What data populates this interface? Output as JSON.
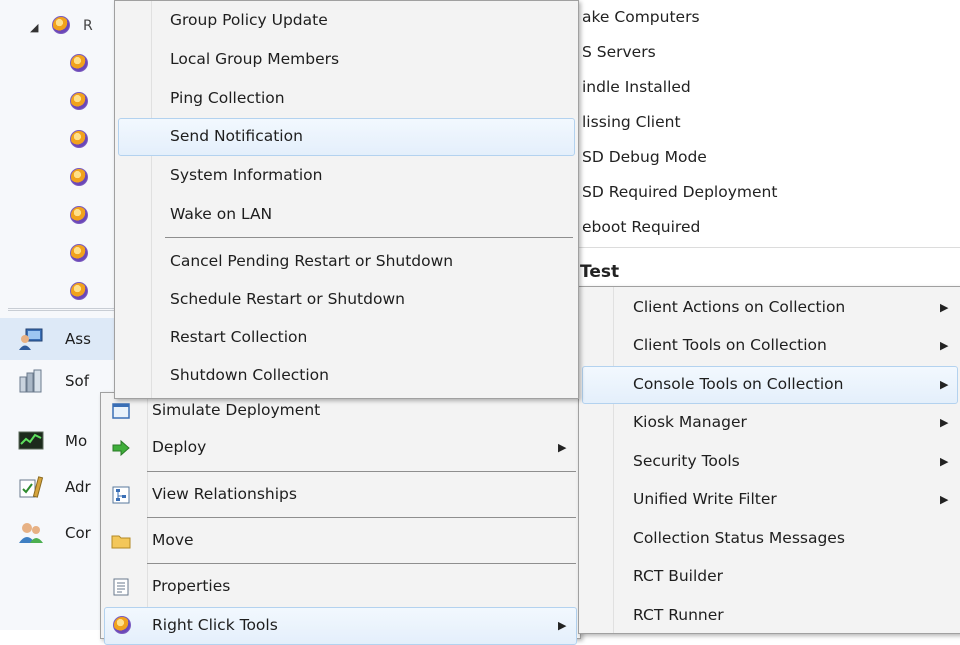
{
  "tree": {
    "root_label": "R",
    "workspaces": [
      {
        "label": "Ass",
        "icon": "assets-icon"
      },
      {
        "label": "Sof",
        "icon": "software-library-icon"
      },
      {
        "label": "Mo",
        "icon": "monitoring-icon"
      },
      {
        "label": "Adr",
        "icon": "administration-icon"
      },
      {
        "label": "Cor",
        "icon": "community-icon"
      }
    ]
  },
  "background_list": {
    "items": [
      "ake Computers",
      "S Servers",
      "indle Installed",
      "lissing Client",
      "SD Debug Mode",
      "SD Required Deployment",
      "eboot Required"
    ],
    "heading": "Test"
  },
  "context_menu": {
    "items": [
      {
        "label": "Simulate Deployment",
        "icon": "simulate-deployment-icon"
      },
      {
        "label": "Deploy",
        "icon": "deploy-arrow-icon",
        "arrow": "▶"
      },
      {
        "label": "View Relationships",
        "icon": "relationships-icon"
      },
      {
        "label": "Move",
        "icon": "folder-icon"
      },
      {
        "label": "Properties",
        "icon": "properties-icon"
      },
      {
        "label": "Right Click Tools",
        "icon": "right-click-tools-icon",
        "arrow": "▶"
      }
    ]
  },
  "console_tools_submenu": {
    "items": [
      "Group Policy Update",
      "Local Group Members",
      "Ping Collection",
      "Send Notification",
      "System Information",
      "Wake on LAN",
      "Cancel Pending Restart or Shutdown",
      "Schedule Restart or Shutdown",
      "Restart Collection",
      "Shutdown Collection"
    ],
    "highlighted": "Send Notification"
  },
  "right_click_tools_submenu": {
    "items": [
      {
        "label": "Client Actions on Collection",
        "arrow": "▶"
      },
      {
        "label": "Client Tools on Collection",
        "arrow": "▶"
      },
      {
        "label": "Console Tools on Collection",
        "arrow": "▶"
      },
      {
        "label": "Kiosk Manager",
        "arrow": "▶"
      },
      {
        "label": "Security Tools",
        "arrow": "▶"
      },
      {
        "label": "Unified Write Filter",
        "arrow": "▶"
      },
      {
        "label": "Collection Status Messages",
        "arrow": ""
      },
      {
        "label": "RCT Builder",
        "arrow": ""
      },
      {
        "label": "RCT Runner",
        "arrow": ""
      }
    ],
    "highlighted": "Console Tools on Collection"
  },
  "colors": {
    "menu_bg": "#f3f3f3",
    "highlight_bg": "#e4effb",
    "highlight_border": "#b3d2ef",
    "tree_bg": "#f6f8fb"
  }
}
